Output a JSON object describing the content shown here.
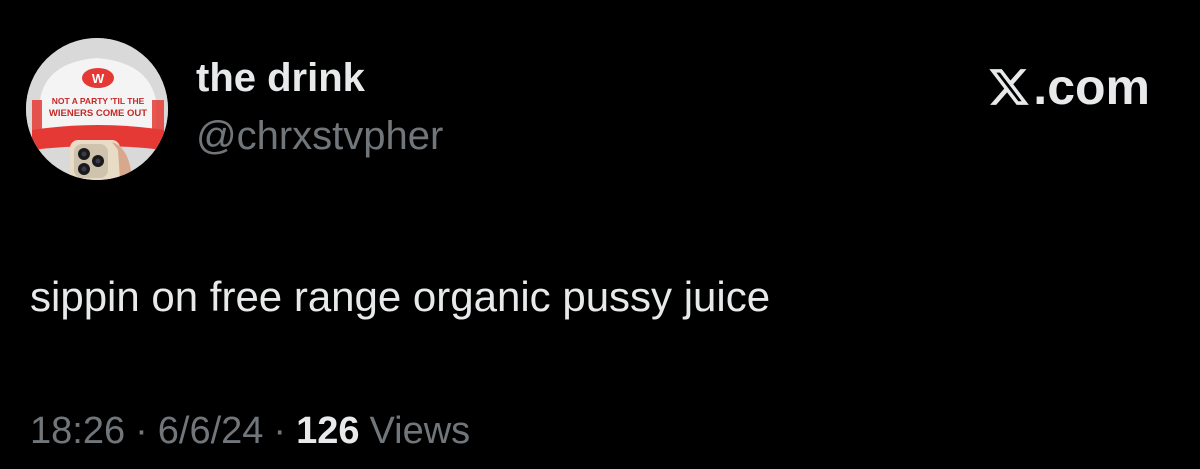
{
  "tweet": {
    "display_name": "the drink",
    "handle": "@chrxstvpher",
    "text": "sippin on free range organic pussy juice",
    "time": "18:26",
    "date": "6/6/24",
    "separator": "·",
    "views_count": "126",
    "views_label": "Views"
  },
  "brand": {
    "domain": ".com",
    "icon": "x-logo-icon"
  },
  "avatar": {
    "icon": "hat-and-phone-photo",
    "logo_text": "W",
    "hat_text_line1": "NOT A PARTY 'TIL THE",
    "hat_text_line2": "WIENERS COME OUT"
  },
  "colors": {
    "background": "#000000",
    "primary_text": "#e7e9ea",
    "secondary_text": "#71767b",
    "hat_red": "#e53935"
  }
}
